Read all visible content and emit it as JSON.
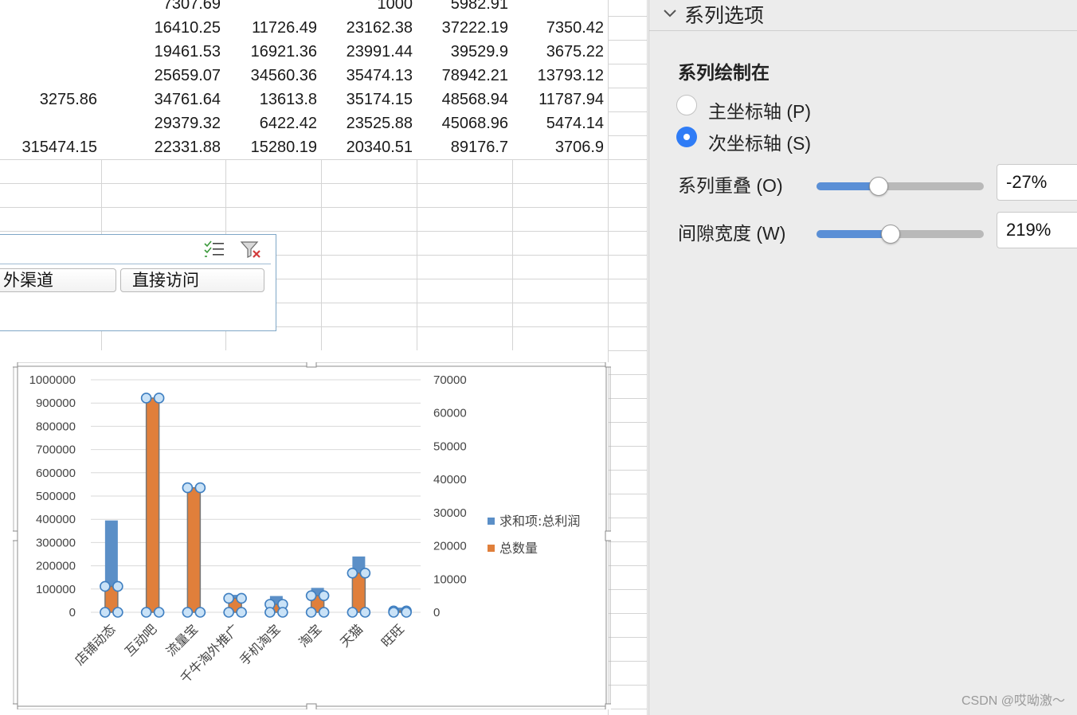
{
  "sheet": {
    "rows": [
      [
        "",
        "7307.69",
        "",
        "1000",
        "5982.91",
        ""
      ],
      [
        "",
        "16410.25",
        "11726.49",
        "23162.38",
        "37222.19",
        "7350.42"
      ],
      [
        "",
        "19461.53",
        "16921.36",
        "23991.44",
        "39529.9",
        "3675.22"
      ],
      [
        "",
        "25659.07",
        "34560.36",
        "35474.13",
        "78942.21",
        "13793.12"
      ],
      [
        "3275.86",
        "34761.64",
        "13613.8",
        "35174.15",
        "48568.94",
        "11787.94"
      ],
      [
        "",
        "29379.32",
        "6422.42",
        "23525.88",
        "45068.96",
        "5474.14"
      ],
      [
        "315474.15",
        "22331.88",
        "15280.19",
        "20340.51",
        "89176.7",
        "3706.9"
      ]
    ]
  },
  "slicer": {
    "buttons": [
      "外渠道",
      "直接访问"
    ],
    "icons": [
      "multi-select-icon",
      "clear-filter-icon"
    ]
  },
  "chart_data": {
    "type": "bar",
    "categories": [
      "店铺动态",
      "互动吧",
      "流量宝",
      "千牛淘外推广",
      "手机淘宝",
      "淘宝",
      "天猫",
      "旺旺"
    ],
    "series": [
      {
        "name": "求和项:总利润",
        "axis": "primary",
        "color": "#5b8fc7",
        "values": [
          395000,
          0,
          0,
          75000,
          70000,
          105000,
          240000,
          20000
        ]
      },
      {
        "name": "总数量",
        "axis": "secondary",
        "color": "#e07f3b",
        "values": [
          7800,
          64500,
          37500,
          4200,
          2400,
          5000,
          11800,
          400
        ]
      }
    ],
    "ylim": [
      0,
      1000000
    ],
    "ylim_secondary": [
      0,
      70000
    ],
    "yticks": [
      "1000000",
      "900000",
      "800000",
      "700000",
      "600000",
      "500000",
      "400000",
      "300000",
      "200000",
      "100000",
      "0"
    ],
    "yticks_secondary": [
      "70000",
      "60000",
      "50000",
      "40000",
      "30000",
      "20000",
      "10000",
      "0"
    ],
    "grid": true,
    "legend": "right"
  },
  "panel": {
    "section_title": "系列选项",
    "plot_on_label": "系列绘制在",
    "primary_axis_label": "主坐标轴 (P)",
    "secondary_axis_label": "次坐标轴 (S)",
    "selected_axis": "secondary",
    "overlap_label": "系列重叠 (O)",
    "overlap_value": "-27%",
    "overlap_fraction": 0.365,
    "gap_label": "间隙宽度 (W)",
    "gap_value": "219%",
    "gap_fraction": 0.438,
    "accent": "#2f7cf6"
  },
  "watermark": "CSDN @哎呦激～"
}
